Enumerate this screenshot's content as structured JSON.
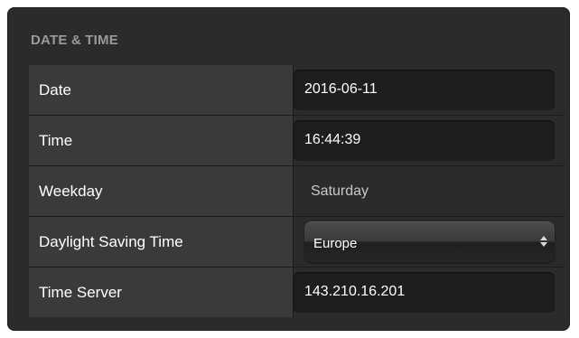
{
  "section": {
    "title": "DATE & TIME"
  },
  "rows": [
    {
      "label": "Date",
      "value": "2016-06-11",
      "kind": "input"
    },
    {
      "label": "Time",
      "value": "16:44:39",
      "kind": "input"
    },
    {
      "label": "Weekday",
      "value": "Saturday",
      "kind": "static"
    },
    {
      "label": "Daylight Saving Time",
      "value": "Europe",
      "kind": "select"
    },
    {
      "label": "Time Server",
      "value": "143.210.16.201",
      "kind": "input"
    }
  ],
  "icons": {
    "select_arrows": "updown-chevron-icon"
  },
  "colors": {
    "panel_background": "#2b2b2b",
    "label_cell_background": "#3a3a3a",
    "field_background": "#1e1e1e",
    "title_color": "#9a9a9a",
    "text_color": "#ffffff"
  }
}
